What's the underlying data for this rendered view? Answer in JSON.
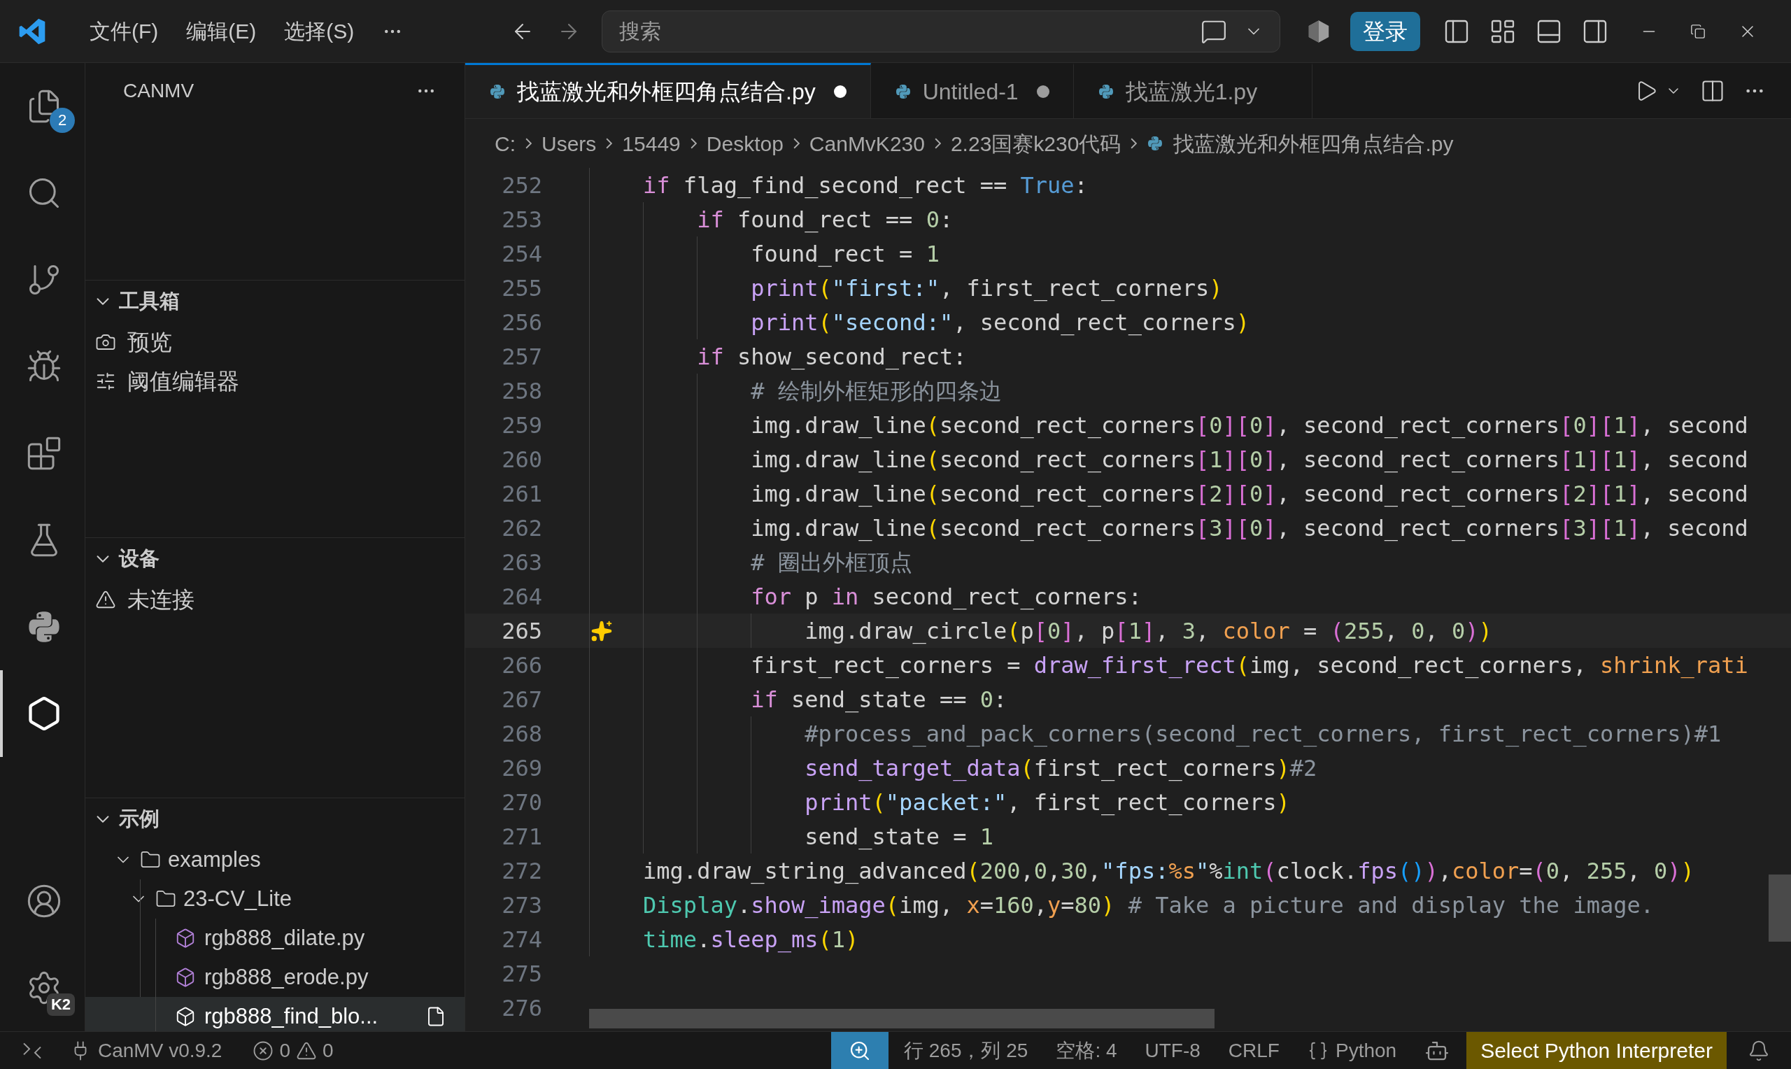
{
  "title_bar": {
    "menus": [
      "文件(F)",
      "编辑(E)",
      "选择(S)"
    ],
    "search": {
      "placeholder": "搜索"
    },
    "sign_in": "登录"
  },
  "activity_bar": [
    {
      "kind": "explorer",
      "selected": false,
      "badge": "2"
    },
    {
      "kind": "search",
      "selected": false
    },
    {
      "kind": "scm",
      "selected": false
    },
    {
      "kind": "debug",
      "selected": false
    },
    {
      "kind": "extensions",
      "selected": false
    },
    {
      "kind": "testing",
      "selected": false
    },
    {
      "kind": "python",
      "selected": false
    },
    {
      "kind": "canmv",
      "selected": true
    },
    {
      "kind": "accounts",
      "selected": false
    },
    {
      "kind": "manage",
      "selected": false,
      "badge": "K2"
    }
  ],
  "sidebar": {
    "title": "CANMV",
    "sections": [
      {
        "title": "工具箱",
        "expanded": true,
        "items": [
          {
            "kind": "camera",
            "label": "预览"
          },
          {
            "kind": "sliders",
            "label": "阈值编辑器"
          }
        ]
      },
      {
        "title": "设备",
        "expanded": true,
        "items": [
          {
            "kind": "warning",
            "label": "未连接"
          }
        ]
      },
      {
        "title": "示例",
        "expanded": true,
        "tree": [
          {
            "label": "examples",
            "kind": "folder",
            "expanded": true,
            "children": [
              {
                "label": "23-CV_Lite",
                "kind": "folder",
                "expanded": true,
                "children": [
                  {
                    "label": "rgb888_dilate.py",
                    "kind": "file",
                    "selected": false
                  },
                  {
                    "label": "rgb888_erode.py",
                    "kind": "file",
                    "selected": false
                  },
                  {
                    "label": "rgb888_find_blo...",
                    "kind": "file",
                    "selected": true
                  }
                ]
              }
            ]
          }
        ]
      }
    ]
  },
  "tabs": [
    {
      "label": "找蓝激光和外框四角点结合.py",
      "selected": true,
      "modified": true
    },
    {
      "label": "Untitled-1",
      "selected": false,
      "modified": true
    },
    {
      "label": "找蓝激光1.py",
      "selected": false,
      "modified": false
    }
  ],
  "breadcrumb": [
    {
      "kind": "folder",
      "label": "C:"
    },
    {
      "kind": "folder",
      "label": "Users"
    },
    {
      "kind": "folder",
      "label": "15449"
    },
    {
      "kind": "folder",
      "label": "Desktop"
    },
    {
      "kind": "folder",
      "label": "CanMvK230"
    },
    {
      "kind": "folder",
      "label": "2.23国赛k230代码"
    },
    {
      "kind": "file",
      "label": "找蓝激光和外框四角点结合.py"
    }
  ],
  "code": [
    {
      "number": "252",
      "current": false,
      "tokens": [
        {
          "kind": "kw",
          "text": "    if"
        },
        {
          "kind": "plain",
          "text": " flag_find_second_rect == "
        },
        {
          "kind": "const",
          "text": "True"
        },
        {
          "kind": "plain",
          "text": ":"
        }
      ]
    },
    {
      "number": "253",
      "current": false,
      "tokens": [
        {
          "kind": "kw",
          "text": "        if"
        },
        {
          "kind": "plain",
          "text": " found_rect == "
        },
        {
          "kind": "num",
          "text": "0"
        },
        {
          "kind": "plain",
          "text": ":"
        }
      ]
    },
    {
      "number": "254",
      "current": false,
      "tokens": [
        {
          "kind": "plain",
          "text": "            found_rect = "
        },
        {
          "kind": "num",
          "text": "1"
        }
      ]
    },
    {
      "number": "255",
      "current": false,
      "tokens": [
        {
          "kind": "fn",
          "text": "            print"
        },
        {
          "kind": "b1",
          "text": "("
        },
        {
          "kind": "str",
          "text": "\"first:\""
        },
        {
          "kind": "plain",
          "text": ", first_rect_corners"
        },
        {
          "kind": "b1",
          "text": ")"
        }
      ]
    },
    {
      "number": "256",
      "current": false,
      "tokens": [
        {
          "kind": "fn",
          "text": "            print"
        },
        {
          "kind": "b1",
          "text": "("
        },
        {
          "kind": "str",
          "text": "\"second:\""
        },
        {
          "kind": "plain",
          "text": ", second_rect_corners"
        },
        {
          "kind": "b1",
          "text": ")"
        }
      ]
    },
    {
      "number": "257",
      "current": false,
      "tokens": [
        {
          "kind": "kw",
          "text": "        if"
        },
        {
          "kind": "plain",
          "text": " show_second_rect:"
        }
      ]
    },
    {
      "number": "258",
      "current": false,
      "tokens": [
        {
          "kind": "cmt",
          "text": "            # 绘制外框矩形的四条边"
        }
      ]
    },
    {
      "number": "259",
      "current": false,
      "tokens": [
        {
          "kind": "plain",
          "text": "            img.draw_line"
        },
        {
          "kind": "b1",
          "text": "("
        },
        {
          "kind": "plain",
          "text": "second_rect_corners"
        },
        {
          "kind": "b2",
          "text": "["
        },
        {
          "kind": "num",
          "text": "0"
        },
        {
          "kind": "b2",
          "text": "]["
        },
        {
          "kind": "num",
          "text": "0"
        },
        {
          "kind": "b2",
          "text": "]"
        },
        {
          "kind": "plain",
          "text": ", second_rect_corners"
        },
        {
          "kind": "b2",
          "text": "["
        },
        {
          "kind": "num",
          "text": "0"
        },
        {
          "kind": "b2",
          "text": "]["
        },
        {
          "kind": "num",
          "text": "1"
        },
        {
          "kind": "b2",
          "text": "]"
        },
        {
          "kind": "plain",
          "text": ", second"
        }
      ]
    },
    {
      "number": "260",
      "current": false,
      "tokens": [
        {
          "kind": "plain",
          "text": "            img.draw_line"
        },
        {
          "kind": "b1",
          "text": "("
        },
        {
          "kind": "plain",
          "text": "second_rect_corners"
        },
        {
          "kind": "b2",
          "text": "["
        },
        {
          "kind": "num",
          "text": "1"
        },
        {
          "kind": "b2",
          "text": "]["
        },
        {
          "kind": "num",
          "text": "0"
        },
        {
          "kind": "b2",
          "text": "]"
        },
        {
          "kind": "plain",
          "text": ", second_rect_corners"
        },
        {
          "kind": "b2",
          "text": "["
        },
        {
          "kind": "num",
          "text": "1"
        },
        {
          "kind": "b2",
          "text": "]["
        },
        {
          "kind": "num",
          "text": "1"
        },
        {
          "kind": "b2",
          "text": "]"
        },
        {
          "kind": "plain",
          "text": ", second"
        }
      ]
    },
    {
      "number": "261",
      "current": false,
      "tokens": [
        {
          "kind": "plain",
          "text": "            img.draw_line"
        },
        {
          "kind": "b1",
          "text": "("
        },
        {
          "kind": "plain",
          "text": "second_rect_corners"
        },
        {
          "kind": "b2",
          "text": "["
        },
        {
          "kind": "num",
          "text": "2"
        },
        {
          "kind": "b2",
          "text": "]["
        },
        {
          "kind": "num",
          "text": "0"
        },
        {
          "kind": "b2",
          "text": "]"
        },
        {
          "kind": "plain",
          "text": ", second_rect_corners"
        },
        {
          "kind": "b2",
          "text": "["
        },
        {
          "kind": "num",
          "text": "2"
        },
        {
          "kind": "b2",
          "text": "]["
        },
        {
          "kind": "num",
          "text": "1"
        },
        {
          "kind": "b2",
          "text": "]"
        },
        {
          "kind": "plain",
          "text": ", second"
        }
      ]
    },
    {
      "number": "262",
      "current": false,
      "tokens": [
        {
          "kind": "plain",
          "text": "            img.draw_line"
        },
        {
          "kind": "b1",
          "text": "("
        },
        {
          "kind": "plain",
          "text": "second_rect_corners"
        },
        {
          "kind": "b2",
          "text": "["
        },
        {
          "kind": "num",
          "text": "3"
        },
        {
          "kind": "b2",
          "text": "]["
        },
        {
          "kind": "num",
          "text": "0"
        },
        {
          "kind": "b2",
          "text": "]"
        },
        {
          "kind": "plain",
          "text": ", second_rect_corners"
        },
        {
          "kind": "b2",
          "text": "["
        },
        {
          "kind": "num",
          "text": "3"
        },
        {
          "kind": "b2",
          "text": "]["
        },
        {
          "kind": "num",
          "text": "1"
        },
        {
          "kind": "b2",
          "text": "]"
        },
        {
          "kind": "plain",
          "text": ", second"
        }
      ]
    },
    {
      "number": "263",
      "current": false,
      "tokens": [
        {
          "kind": "cmt",
          "text": "            # 圈出外框顶点"
        }
      ]
    },
    {
      "number": "264",
      "current": false,
      "tokens": [
        {
          "kind": "kw",
          "text": "            for"
        },
        {
          "kind": "plain",
          "text": " p "
        },
        {
          "kind": "kw",
          "text": "in"
        },
        {
          "kind": "plain",
          "text": " second_rect_corners:"
        }
      ]
    },
    {
      "number": "265",
      "current": true,
      "tokens": [
        {
          "kind": "plain",
          "text": "                img.draw_circle"
        },
        {
          "kind": "b1",
          "text": "("
        },
        {
          "kind": "plain",
          "text": "p"
        },
        {
          "kind": "b2",
          "text": "["
        },
        {
          "kind": "num",
          "text": "0"
        },
        {
          "kind": "b2",
          "text": "]"
        },
        {
          "kind": "plain",
          "text": ", p"
        },
        {
          "kind": "b2",
          "text": "["
        },
        {
          "kind": "num",
          "text": "1"
        },
        {
          "kind": "b2",
          "text": "]"
        },
        {
          "kind": "plain",
          "text": ", "
        },
        {
          "kind": "num",
          "text": "3"
        },
        {
          "kind": "plain",
          "text": ", "
        },
        {
          "kind": "param",
          "text": "color"
        },
        {
          "kind": "plain",
          "text": " = "
        },
        {
          "kind": "b2",
          "text": "("
        },
        {
          "kind": "num",
          "text": "255"
        },
        {
          "kind": "plain",
          "text": ", "
        },
        {
          "kind": "num",
          "text": "0"
        },
        {
          "kind": "plain",
          "text": ", "
        },
        {
          "kind": "num",
          "text": "0"
        },
        {
          "kind": "b2",
          "text": ")"
        },
        {
          "kind": "b1",
          "text": ")"
        }
      ]
    },
    {
      "number": "266",
      "current": false,
      "tokens": [
        {
          "kind": "plain",
          "text": "            first_rect_corners = "
        },
        {
          "kind": "fn",
          "text": "draw_first_rect"
        },
        {
          "kind": "b1",
          "text": "("
        },
        {
          "kind": "plain",
          "text": "img, second_rect_corners, "
        },
        {
          "kind": "param",
          "text": "shrink_rati"
        }
      ]
    },
    {
      "number": "267",
      "current": false,
      "tokens": [
        {
          "kind": "kw",
          "text": "            if"
        },
        {
          "kind": "plain",
          "text": " send_state == "
        },
        {
          "kind": "num",
          "text": "0"
        },
        {
          "kind": "plain",
          "text": ":"
        }
      ]
    },
    {
      "number": "268",
      "current": false,
      "tokens": [
        {
          "kind": "cmt",
          "text": "                #process_and_pack_corners(second_rect_corners, first_rect_corners)#1"
        }
      ]
    },
    {
      "number": "269",
      "current": false,
      "tokens": [
        {
          "kind": "fn",
          "text": "                send_target_data"
        },
        {
          "kind": "b1",
          "text": "("
        },
        {
          "kind": "plain",
          "text": "first_rect_corners"
        },
        {
          "kind": "b1",
          "text": ")"
        },
        {
          "kind": "cmt",
          "text": "#2"
        }
      ]
    },
    {
      "number": "270",
      "current": false,
      "tokens": [
        {
          "kind": "fn",
          "text": "                print"
        },
        {
          "kind": "b1",
          "text": "("
        },
        {
          "kind": "str",
          "text": "\"packet:\""
        },
        {
          "kind": "plain",
          "text": ", first_rect_corners"
        },
        {
          "kind": "b1",
          "text": ")"
        }
      ]
    },
    {
      "number": "271",
      "current": false,
      "tokens": [
        {
          "kind": "plain",
          "text": "                send_state = "
        },
        {
          "kind": "num",
          "text": "1"
        }
      ]
    },
    {
      "number": "272",
      "current": false,
      "tokens": [
        {
          "kind": "plain",
          "text": "    img.draw_string_advanced"
        },
        {
          "kind": "b1",
          "text": "("
        },
        {
          "kind": "num",
          "text": "200"
        },
        {
          "kind": "plain",
          "text": ","
        },
        {
          "kind": "num",
          "text": "0"
        },
        {
          "kind": "plain",
          "text": ","
        },
        {
          "kind": "num",
          "text": "30"
        },
        {
          "kind": "plain",
          "text": ","
        },
        {
          "kind": "str",
          "text": "\"fps:"
        },
        {
          "kind": "param",
          "text": "%s"
        },
        {
          "kind": "str",
          "text": "\""
        },
        {
          "kind": "plain",
          "text": "%"
        },
        {
          "kind": "cls",
          "text": "int"
        },
        {
          "kind": "b2",
          "text": "("
        },
        {
          "kind": "plain",
          "text": "clock."
        },
        {
          "kind": "fn",
          "text": "fps"
        },
        {
          "kind": "b3",
          "text": "()"
        },
        {
          "kind": "b2",
          "text": ")"
        },
        {
          "kind": "plain",
          "text": ","
        },
        {
          "kind": "param",
          "text": "color"
        },
        {
          "kind": "plain",
          "text": "="
        },
        {
          "kind": "b2",
          "text": "("
        },
        {
          "kind": "num",
          "text": "0"
        },
        {
          "kind": "plain",
          "text": ", "
        },
        {
          "kind": "num",
          "text": "255"
        },
        {
          "kind": "plain",
          "text": ", "
        },
        {
          "kind": "num",
          "text": "0"
        },
        {
          "kind": "b2",
          "text": ")"
        },
        {
          "kind": "b1",
          "text": ")"
        }
      ]
    },
    {
      "number": "273",
      "current": false,
      "tokens": [
        {
          "kind": "cls",
          "text": "    Display"
        },
        {
          "kind": "plain",
          "text": "."
        },
        {
          "kind": "fn",
          "text": "show_image"
        },
        {
          "kind": "b1",
          "text": "("
        },
        {
          "kind": "plain",
          "text": "img, "
        },
        {
          "kind": "param",
          "text": "x"
        },
        {
          "kind": "plain",
          "text": "="
        },
        {
          "kind": "num",
          "text": "160"
        },
        {
          "kind": "plain",
          "text": ","
        },
        {
          "kind": "param",
          "text": "y"
        },
        {
          "kind": "plain",
          "text": "="
        },
        {
          "kind": "num",
          "text": "80"
        },
        {
          "kind": "b1",
          "text": ")"
        },
        {
          "kind": "cmt",
          "text": " # Take a picture and display the image."
        }
      ]
    },
    {
      "number": "274",
      "current": false,
      "tokens": [
        {
          "kind": "cls",
          "text": "    time"
        },
        {
          "kind": "plain",
          "text": "."
        },
        {
          "kind": "fn",
          "text": "sleep_ms"
        },
        {
          "kind": "b1",
          "text": "("
        },
        {
          "kind": "num",
          "text": "1"
        },
        {
          "kind": "b1",
          "text": ")"
        }
      ]
    },
    {
      "number": "275",
      "current": false
    },
    {
      "number": "276",
      "current": false
    }
  ],
  "status_bar": {
    "board": "CanMV v0.9.2",
    "errors": "0",
    "warnings": "0",
    "cursor": "行 265，列 25",
    "indentation": "空格: 4",
    "encoding": "UTF-8",
    "eol": "CRLF",
    "language": "Python",
    "interpreter": "Select Python Interpreter"
  }
}
